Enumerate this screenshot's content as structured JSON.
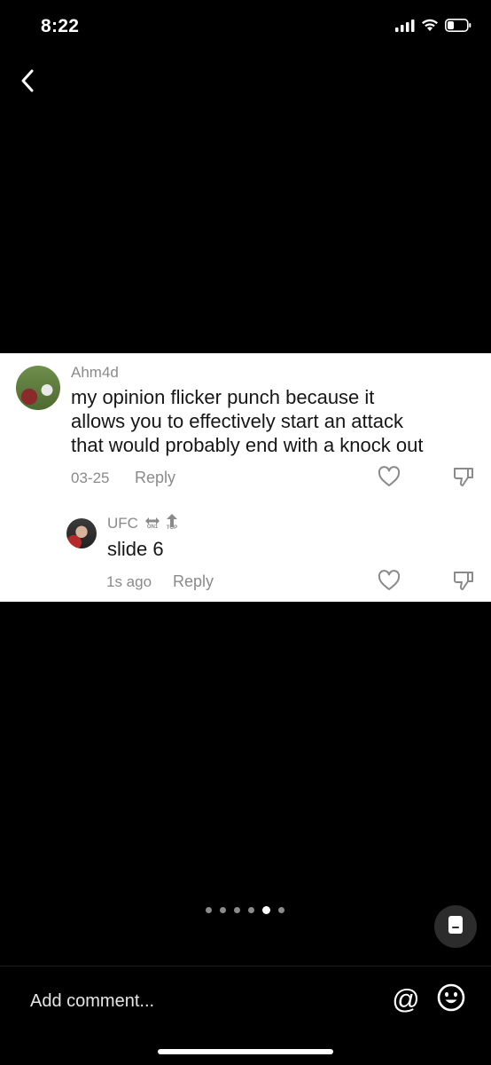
{
  "status_bar": {
    "time": "8:22",
    "icons": [
      "signal-bars-icon",
      "wifi-icon",
      "battery-icon"
    ]
  },
  "nav": {
    "back_icon": "chevron-left-icon"
  },
  "comments": [
    {
      "username": "Ahm4d",
      "text_lines": [
        "my opinion flicker punch because it",
        "allows you to effectively start an attack",
        "that would probably end with a knock out"
      ],
      "date": "03-25",
      "reply_label": "Reply"
    }
  ],
  "reply": {
    "username": "UFC",
    "badges": [
      {
        "icon": "swap-arrows-icon",
        "label": "ON1"
      },
      {
        "icon": "arrow-up-icon",
        "label": "TOP"
      }
    ],
    "text": "slide 6",
    "time": "1s ago",
    "reply_label": "Reply"
  },
  "carousel": {
    "total": 6,
    "active_index": 4
  },
  "composer": {
    "placeholder": "Add comment...",
    "mention_symbol": "@",
    "emoji_icon": "smiley-icon",
    "doc_icon": "document-icon"
  },
  "colors": {
    "background": "#000000",
    "card": "#ffffff",
    "muted": "#8a8a8a"
  }
}
